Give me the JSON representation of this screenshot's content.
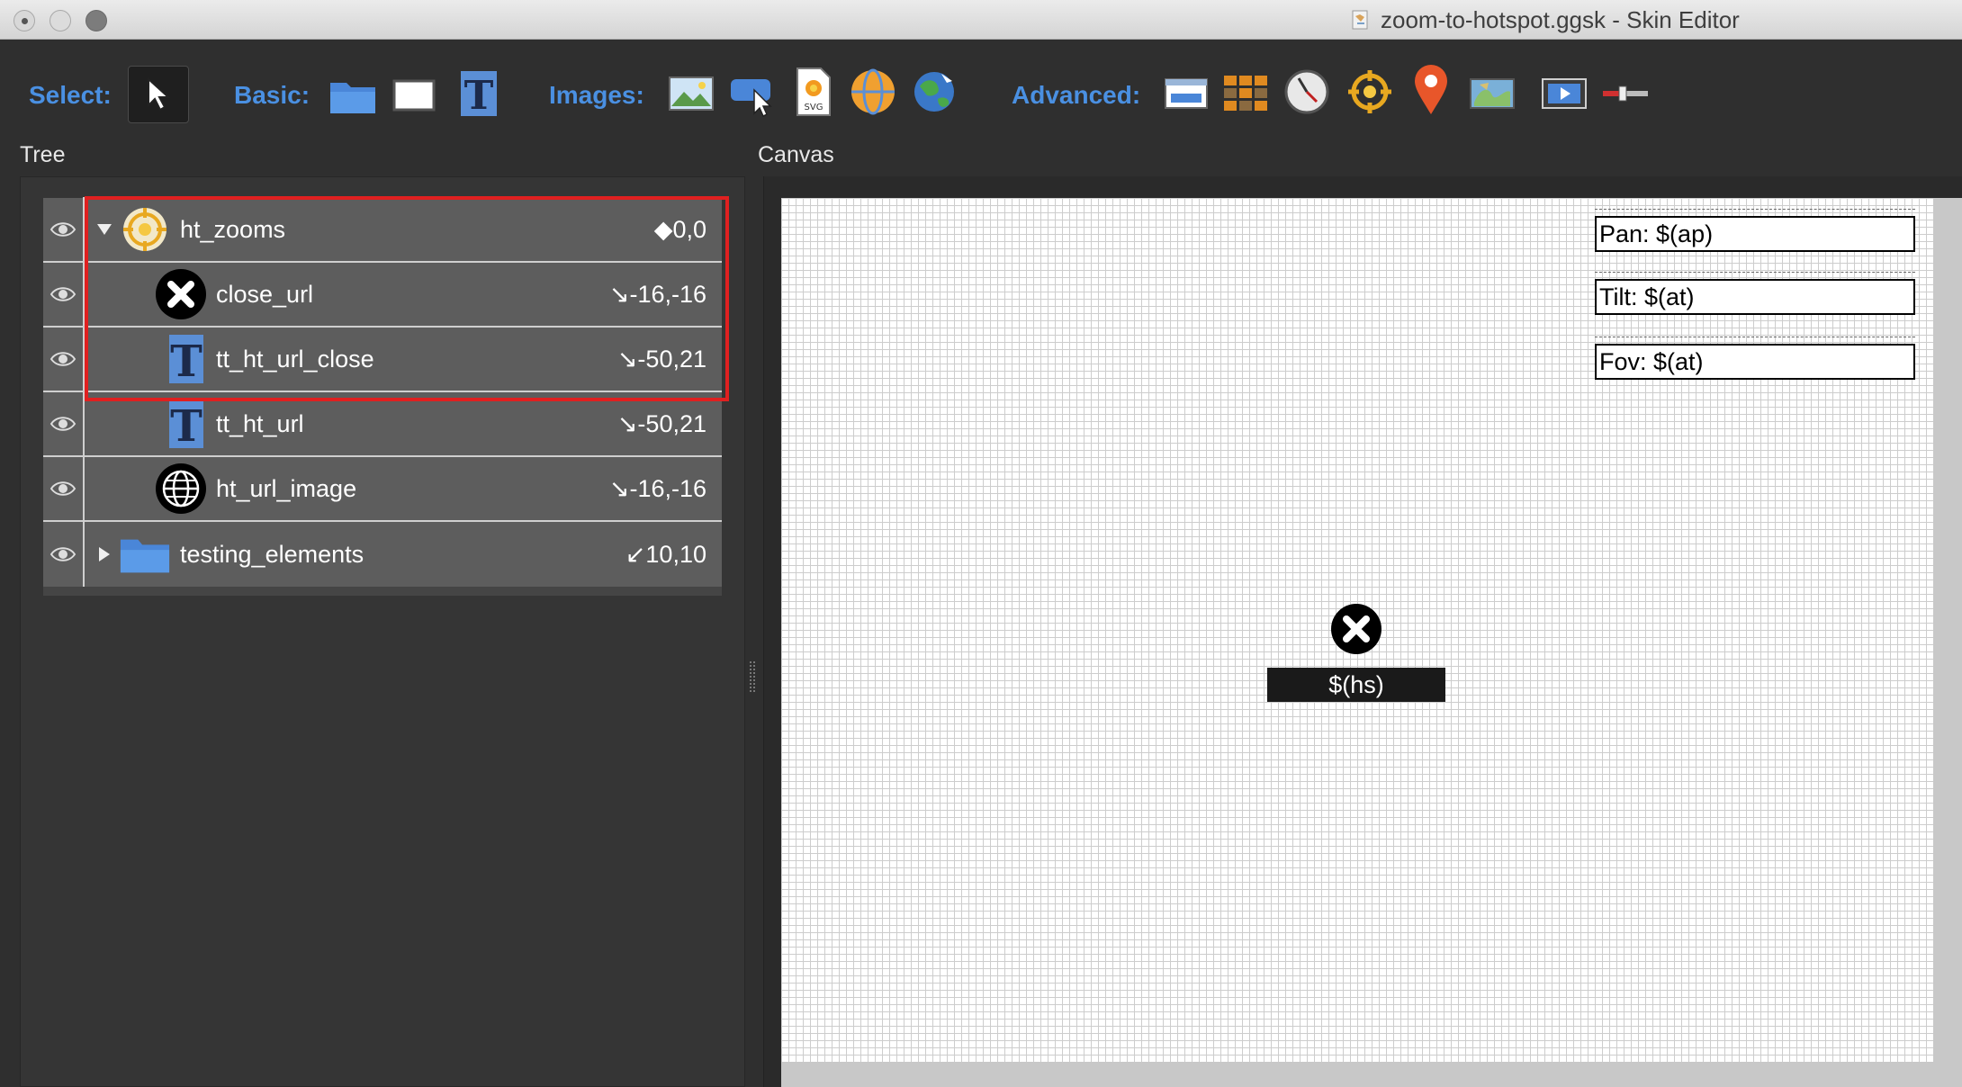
{
  "window": {
    "title": "zoom-to-hotspot.ggsk - Skin Editor"
  },
  "toolbar": {
    "select_label": "Select:",
    "basic_label": "Basic:",
    "images_label": "Images:",
    "advanced_label": "Advanced:",
    "select_icons": [
      "arrow-pointer-icon"
    ],
    "basic_icons": [
      "folder-icon",
      "rectangle-icon",
      "text-icon"
    ],
    "image_icons": [
      "image-icon",
      "button-image-icon",
      "svg-icon",
      "panorama-sphere-icon",
      "globe-icon"
    ],
    "advanced_icons": [
      "map-window-icon",
      "grid-icon",
      "compass-icon",
      "hotspot-target-icon",
      "map-pin-icon",
      "map-icon",
      "video-icon",
      "slider-icon"
    ]
  },
  "panels": {
    "tree_title": "Tree",
    "canvas_title": "Canvas"
  },
  "tree": {
    "items": [
      {
        "name": "ht_zooms",
        "position": "◆0,0",
        "icon": "hotspot-target-icon",
        "expanded": true,
        "level": 0
      },
      {
        "name": "close_url",
        "position": "↘-16,-16",
        "icon": "close-circle-icon",
        "level": 1
      },
      {
        "name": "tt_ht_url_close",
        "position": "↘-50,21",
        "icon": "text-icon",
        "level": 1
      },
      {
        "name": "tt_ht_url",
        "position": "↘-50,21",
        "icon": "text-icon",
        "level": 1
      },
      {
        "name": "ht_url_image",
        "position": "↘-16,-16",
        "icon": "globe-icon",
        "level": 1
      },
      {
        "name": "testing_elements",
        "position": "↙10,10",
        "icon": "folder-icon",
        "expanded": false,
        "level": 0
      }
    ]
  },
  "canvas": {
    "pan_text": "Pan: $(ap)",
    "tilt_text": "Tilt: $(at)",
    "fov_text": "Fov: $(at)",
    "hotspot_label": "$(hs)"
  },
  "colors": {
    "accent": "#4a90e2",
    "highlight": "#e02020",
    "row_bg": "#5d5d5d"
  }
}
